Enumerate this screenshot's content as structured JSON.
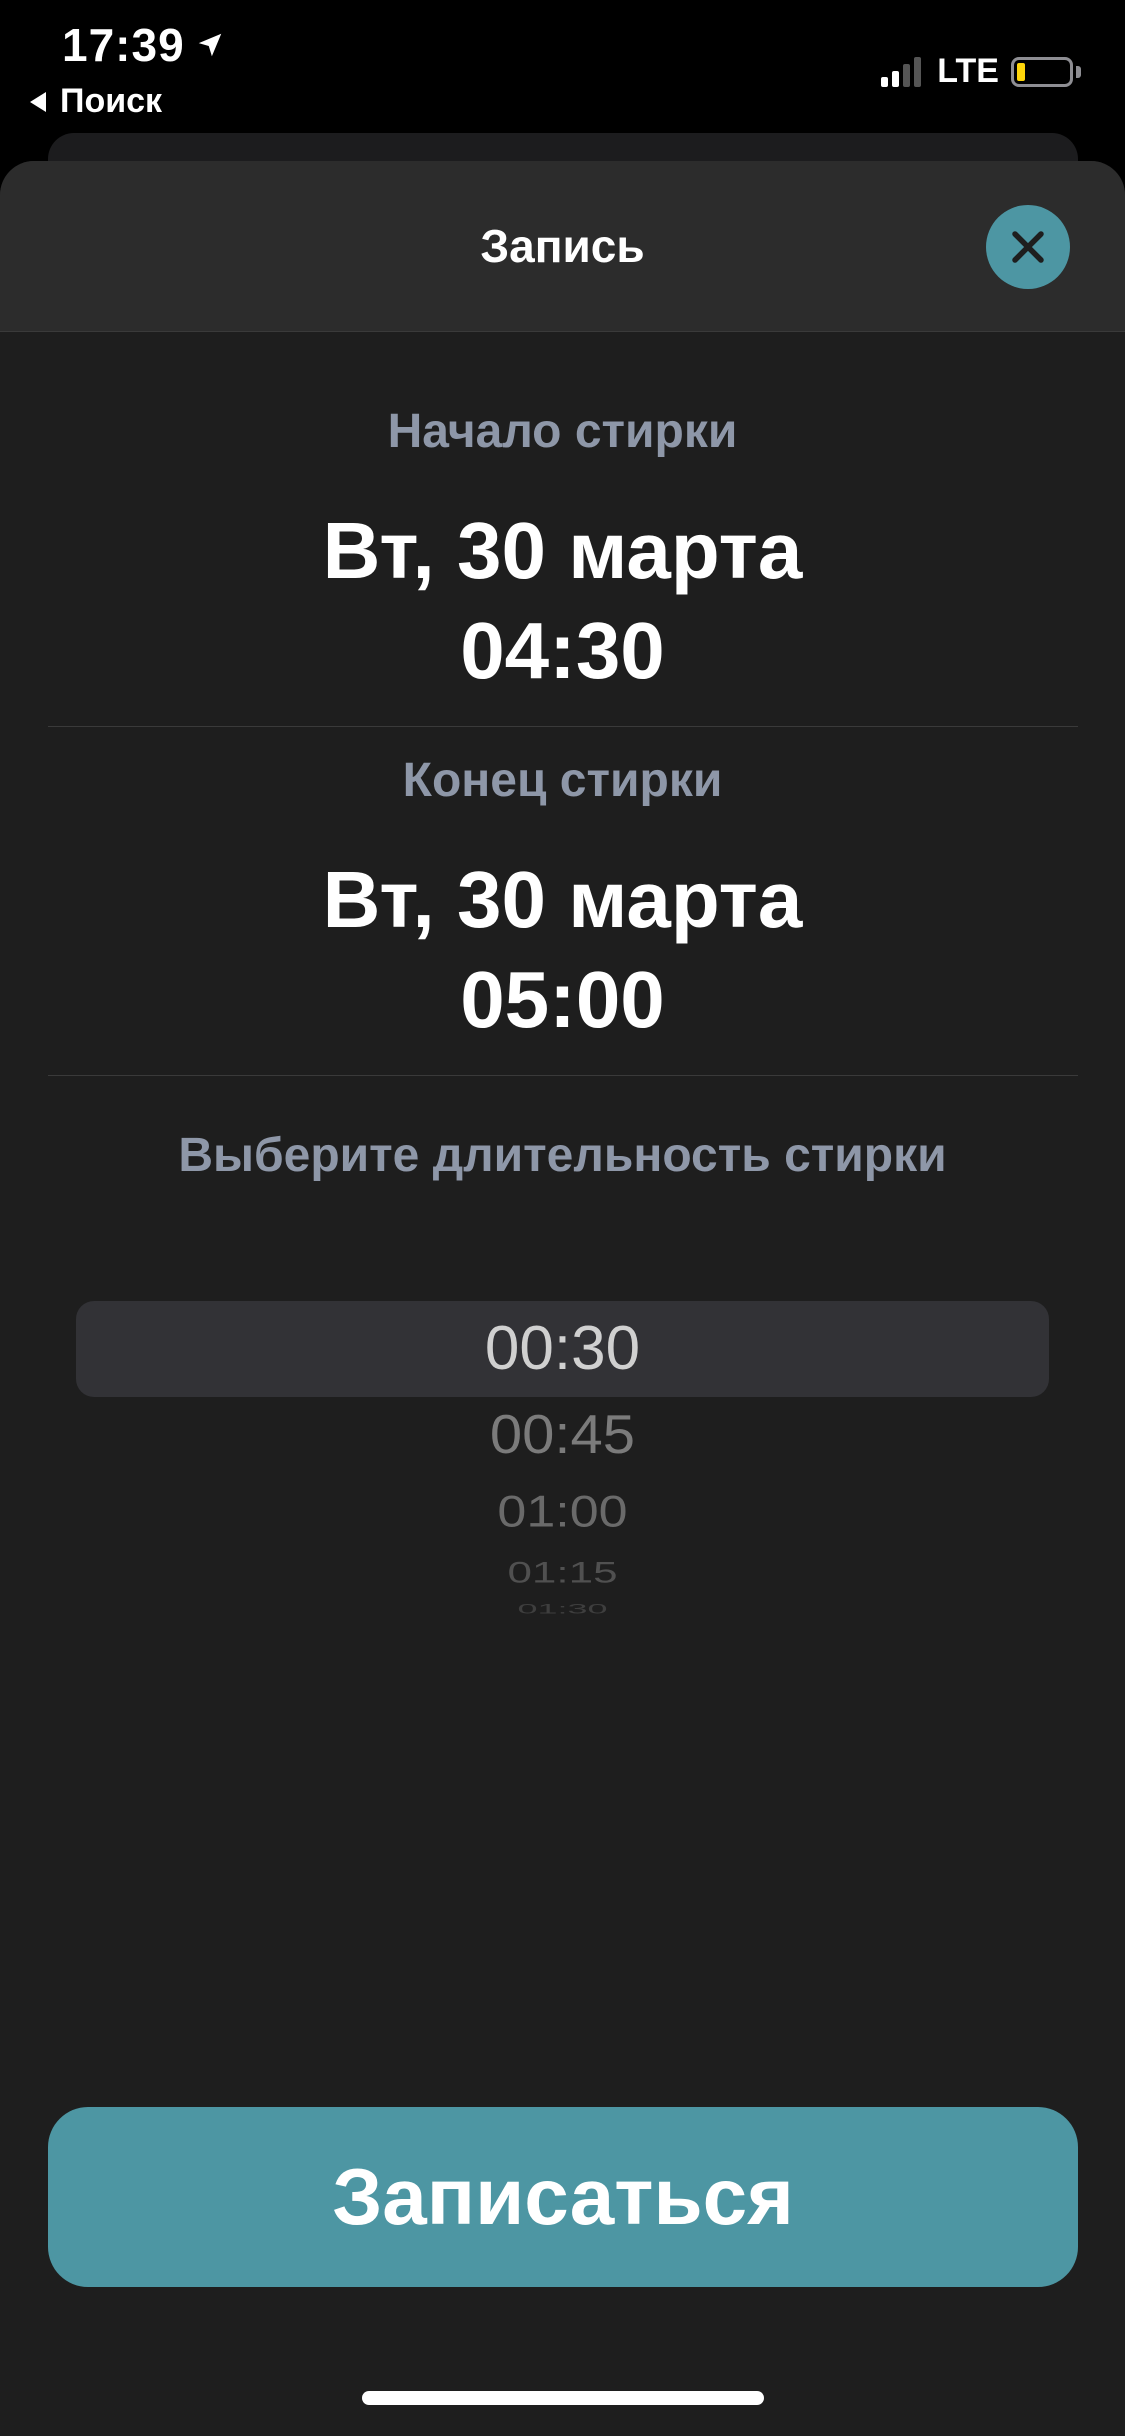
{
  "status_bar": {
    "time": "17:39",
    "back_label": "Поиск",
    "network": "LTE",
    "battery_level": 0.15,
    "battery_color": "#ffd60a"
  },
  "sheet": {
    "title": "Запись"
  },
  "start": {
    "label": "Начало стирки",
    "date": "Вт, 30 марта",
    "time": "04:30"
  },
  "end": {
    "label": "Конец стирки",
    "date": "Вт, 30 марта",
    "time": "05:00"
  },
  "duration": {
    "label": "Выберите длительность стирки",
    "options": [
      "00:30",
      "00:45",
      "01:00",
      "01:15",
      "01:30"
    ],
    "selected": "00:30"
  },
  "submit_label": "Записаться",
  "colors": {
    "accent": "#4d96a3",
    "background": "#1e1e1e",
    "header": "#2c2c2c",
    "muted_label": "#8e97a8"
  }
}
